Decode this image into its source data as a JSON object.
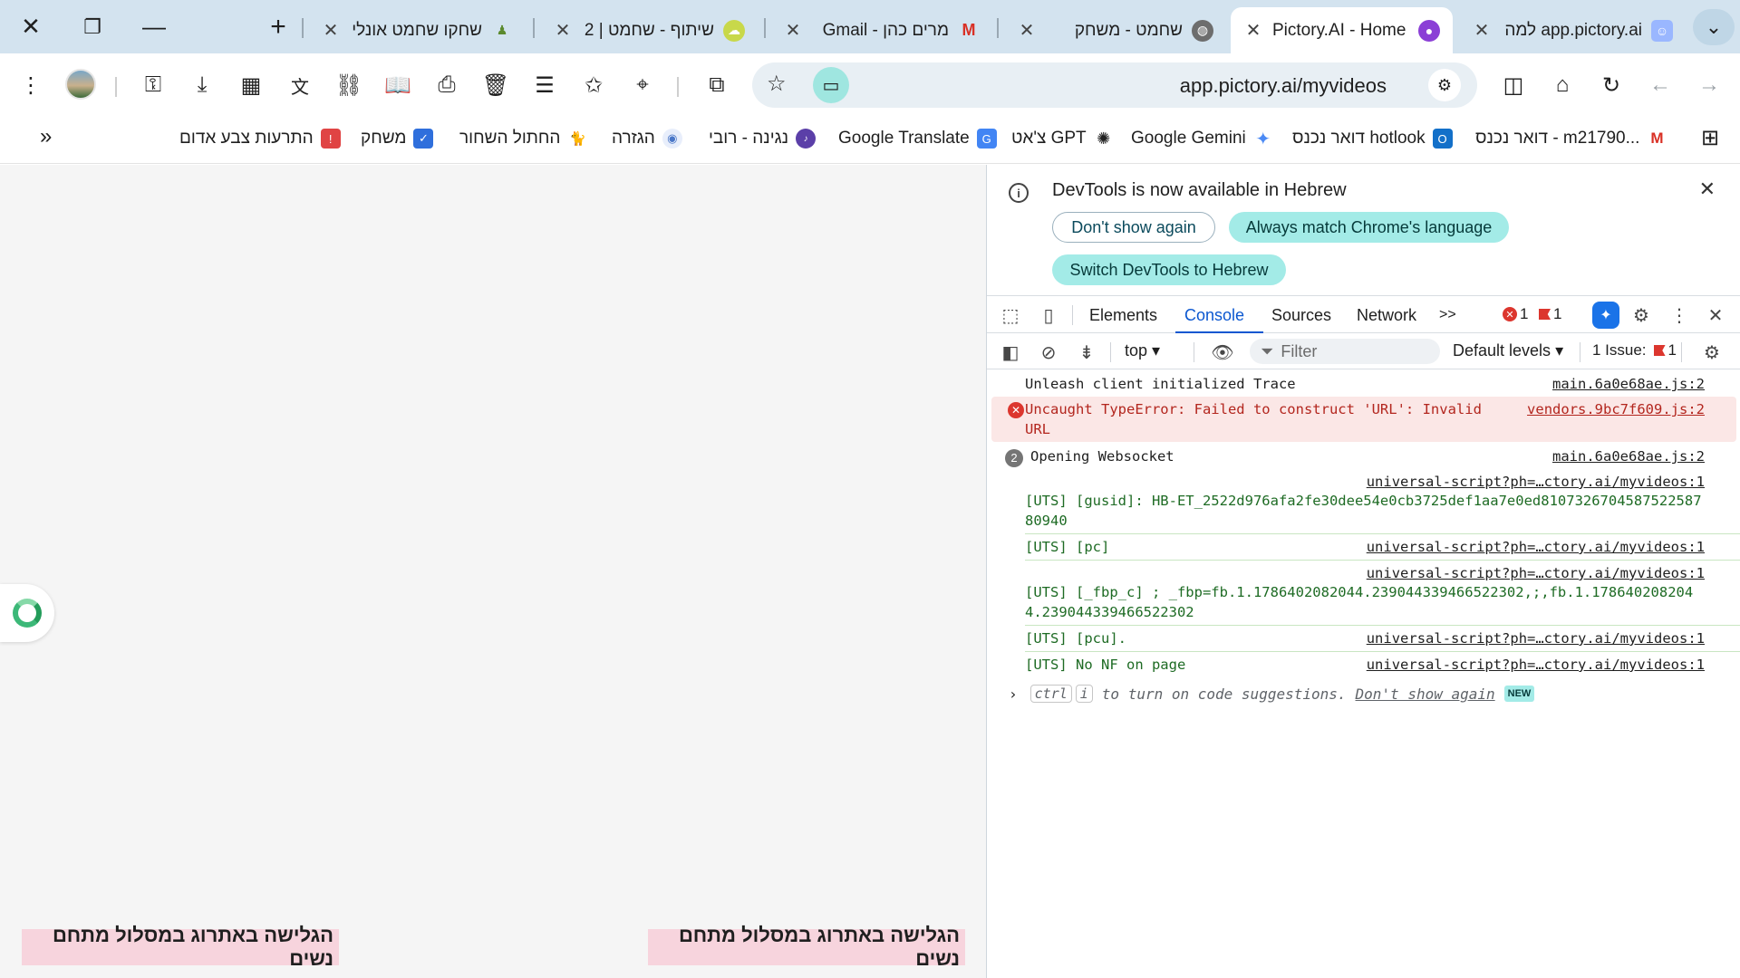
{
  "window": {
    "close_glyph": "✕",
    "restore_glyph": "❐",
    "minimize_glyph": "—",
    "newtab_glyph": "+",
    "tab_search_glyph": "⌄"
  },
  "tabs": [
    {
      "title": "שחקו שחמט אונלי",
      "favicon": "chess-pawn",
      "active": false
    },
    {
      "title": "שיתוף - שחמט | 2",
      "favicon": "chess-share",
      "active": false
    },
    {
      "title": "מרים כהן - Gmail",
      "favicon": "gmail",
      "badge": "0",
      "active": false
    },
    {
      "title": "שחמט - משחק",
      "favicon": "chess-game",
      "active": false
    },
    {
      "title": "Pictory.AI - Home",
      "favicon": "pictory",
      "active": true
    },
    {
      "title": "app.pictory.ai למה",
      "favicon": "pictory-why",
      "active": false
    }
  ],
  "toolbar": {
    "url": "app.pictory.ai/myvideos",
    "icons": [
      "menu-dots-icon",
      "profile-avatar",
      "password-key-icon",
      "download-icon",
      "qr-code-icon",
      "translate-icon",
      "link-icon",
      "reading-mode-icon",
      "print-icon",
      "delete-icon",
      "reading-list-icon",
      "favorites-icon",
      "location-icon",
      "extensions-icon"
    ],
    "right_icons": [
      "split-view-icon",
      "home-icon",
      "reload-icon",
      "back-icon",
      "forward-icon"
    ]
  },
  "bookmarks": {
    "more_glyph": "»",
    "apps_glyph": "⊞",
    "items": [
      {
        "label": "התרעות צבע אדום",
        "icon": "shield-alert-icon",
        "color": "#e04444"
      },
      {
        "label": "משחק",
        "icon": "shield-check-icon",
        "color": "#2f6fdc"
      },
      {
        "label": "החתול השחור",
        "icon": "cat-icon",
        "color": "#222222"
      },
      {
        "label": "הגזרה",
        "icon": "news-icon",
        "color": "#4a77c8"
      },
      {
        "label": "נגינה - רובי",
        "icon": "music-icon",
        "color": "#5b3fa8"
      },
      {
        "label": "Google Translate",
        "icon": "google-translate-icon",
        "color": "#4285f4"
      },
      {
        "label": "צ'אט GPT",
        "icon": "chatgpt-icon",
        "color": "#222222"
      },
      {
        "label": "Google Gemini",
        "icon": "gemini-icon",
        "color": "#4b8af5"
      },
      {
        "label": "דואר נכנס hotlook",
        "icon": "outlook-icon",
        "color": "#1370c9"
      },
      {
        "label": "דואר נכנס - m21790...",
        "icon": "gmail-icon",
        "color": "#d93025",
        "badge": "0"
      }
    ]
  },
  "page": {
    "banner_left": "הגלישה באתרוג במסלול מתחם נשים",
    "banner_right": "הגלישה באתרוג במסלול מתחם נשים"
  },
  "devtools": {
    "info_message": "DevTools is now available in Hebrew",
    "btn_dont_show": "Don't show again",
    "btn_match": "Always match Chrome's language",
    "btn_switch": "Switch DevTools to Hebrew",
    "tabs": [
      "Elements",
      "Console",
      "Sources",
      "Network"
    ],
    "active_tab": "Console",
    "more_tabs_glyph": ">>",
    "error_count": "1",
    "warning_count": "1",
    "context": "top",
    "filter_placeholder": "Filter",
    "levels": "Default levels",
    "issues_label": "1 Issue:",
    "issues_count": "1",
    "logs": [
      {
        "kind": "info",
        "text": "Unleash client initialized Trace",
        "source": "main.6a0e68ae.js:2"
      },
      {
        "kind": "error",
        "text": "Uncaught TypeError: Failed to construct 'URL': Invalid URL",
        "source": "vendors.9bc7f609.js:2"
      },
      {
        "kind": "group",
        "count": "2",
        "text": "Opening Websocket",
        "source": "main.6a0e68ae.js:2"
      },
      {
        "kind": "uts",
        "text": "[UTS] [gusid]: HB-ET_2522d976afa2fe30dee54e0cb3725def1aa7e0ed81073267045875225878094​0",
        "source": "universal-script?ph=…ctory.ai/myvideos:1"
      },
      {
        "kind": "uts",
        "text": "[UTS] [pc]",
        "source": "universal-script?ph=…ctory.ai/myvideos:1"
      },
      {
        "kind": "uts",
        "text": "[UTS] [_fbp_c] ; _fbp=fb.1.1786402082044.239044339466522302,;,fb.1.1786402082044.239044339466522302",
        "source": "universal-script?ph=…ctory.ai/myvideos:1"
      },
      {
        "kind": "uts",
        "text": "[UTS] [pcu].",
        "source": "universal-script?ph=…ctory.ai/myvideos:1"
      },
      {
        "kind": "uts",
        "text": "[UTS] No NF on page",
        "source": "universal-script?ph=…ctory.ai/myvideos:1"
      }
    ],
    "prompt": {
      "key1": "ctrl",
      "key2": "i",
      "text": "to turn on code suggestions.",
      "link": "Don't show again",
      "badge": "NEW"
    }
  }
}
